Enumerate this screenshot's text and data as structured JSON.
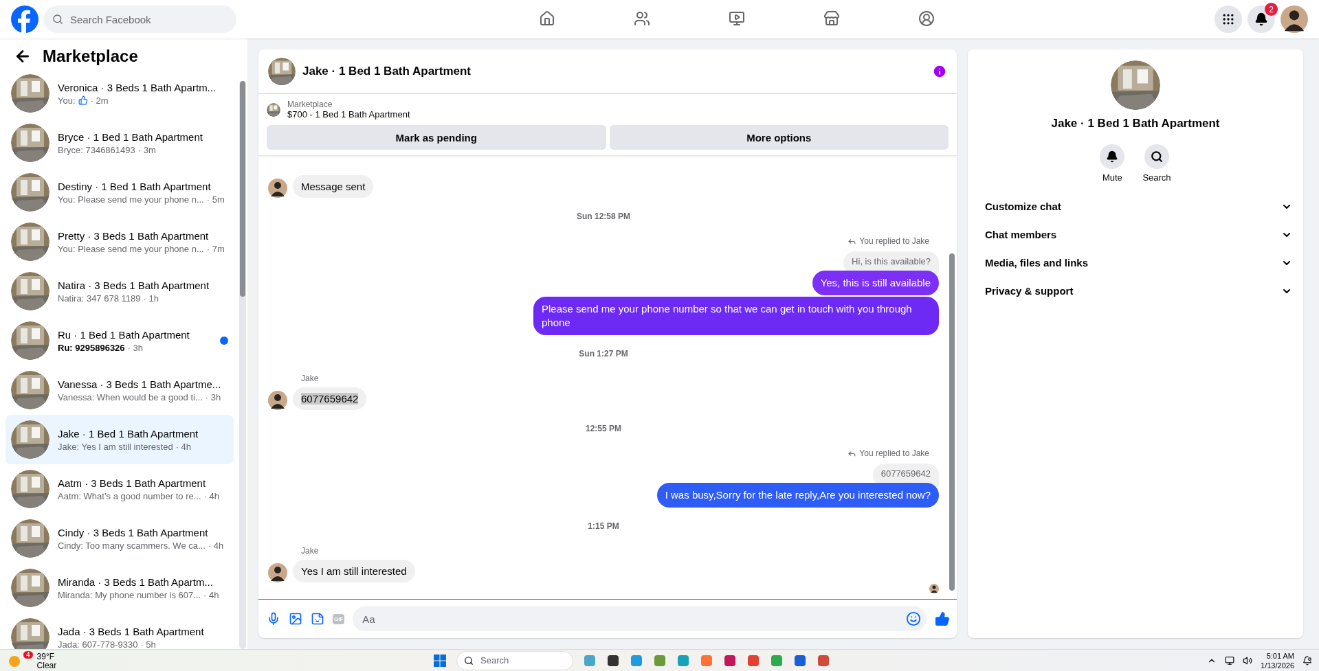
{
  "top_bar": {
    "search": {
      "placeholder": "Search Facebook"
    },
    "nav": [
      {
        "selected": false
      },
      {
        "selected": false
      },
      {
        "selected": false
      },
      {
        "selected": false
      },
      {
        "selected": false
      }
    ],
    "notifications_badge": "2"
  },
  "sidebar": {
    "title": "Marketplace",
    "conversations": [
      {
        "title": "Veronica · 3 Beds 1 Bath Apartm...",
        "preview": "You:",
        "kind": "like",
        "time": "· 2m",
        "unread": false,
        "selected": false
      },
      {
        "title": "Bryce · 1 Bed 1 Bath Apartment",
        "preview": "Bryce: 7346861493",
        "time": "· 3m",
        "unread": false,
        "selected": false
      },
      {
        "title": "Destiny · 1 Bed 1 Bath Apartment",
        "preview": "You: Please send me your phone n...",
        "time": "· 5m",
        "unread": false,
        "selected": false
      },
      {
        "title": "Pretty · 3 Beds 1 Bath Apartment",
        "preview": "You: Please send me your phone n...",
        "time": "· 7m",
        "unread": false,
        "selected": false
      },
      {
        "title": "Natira · 3 Beds 1 Bath Apartment",
        "preview": "Natira: 347 678 1189",
        "time": "· 1h",
        "unread": false,
        "selected": false
      },
      {
        "title": "Ru · 1 Bed 1 Bath Apartment",
        "preview": "Ru: 9295896326",
        "time": "· 3h",
        "unread": true,
        "selected": false
      },
      {
        "title": "Vanessa · 3 Beds 1 Bath Apartme...",
        "preview": "Vanessa: When would be a good ti...",
        "time": "· 3h",
        "unread": false,
        "selected": false
      },
      {
        "title": "Jake · 1 Bed 1 Bath Apartment",
        "preview": "Jake: Yes I am still interested",
        "time": "· 4h",
        "unread": false,
        "selected": true
      },
      {
        "title": "Aatm · 3 Beds 1 Bath Apartment",
        "preview": "Aatm: What’s a good number to re...",
        "time": "· 4h",
        "unread": false,
        "selected": false
      },
      {
        "title": "Cindy · 3 Beds 1 Bath Apartment",
        "preview": "Cindy: Too many scammers. We ca...",
        "time": "· 4h",
        "unread": false,
        "selected": false
      },
      {
        "title": "Miranda · 3 Beds 1 Bath Apartm...",
        "preview": "Miranda: My phone number is 607...",
        "time": "· 4h",
        "unread": false,
        "selected": false
      },
      {
        "title": "Jada · 3 Beds 1 Bath Apartment",
        "preview": "Jada: 607-778-9330",
        "time": "· 5h",
        "unread": false,
        "selected": false
      }
    ]
  },
  "chat": {
    "title": "Jake · 1 Bed 1 Bath Apartment",
    "listing": {
      "source": "Marketplace",
      "name": "$700 - 1 Bed 1 Bath Apartment"
    },
    "buttons": [
      "Mark as pending",
      "More options"
    ],
    "messages": [
      {
        "kind": "incoming",
        "text": "Message sent",
        "avatar": true,
        "highlighted": false
      },
      {
        "kind": "timestamp",
        "text": "Sun 12:58 PM"
      },
      {
        "kind": "reply_note",
        "text": "You replied to Jake"
      },
      {
        "kind": "quoted",
        "text": "Hi, is this available?"
      },
      {
        "kind": "outgoing",
        "text": "Yes, this is still available",
        "color": "#7b2ff7"
      },
      {
        "kind": "outgoing",
        "text": "Please send me your phone  number so that we can get in touch with you through phone",
        "color": "#6d2af5"
      },
      {
        "kind": "timestamp",
        "text": "Sun 1:27 PM"
      },
      {
        "kind": "sender",
        "text": "Jake"
      },
      {
        "kind": "incoming",
        "text": "6077659642",
        "avatar": true,
        "highlighted": true
      },
      {
        "kind": "timestamp",
        "text": "12:55 PM"
      },
      {
        "kind": "reply_note",
        "text": "You replied to Jake"
      },
      {
        "kind": "quoted",
        "text": "6077659642"
      },
      {
        "kind": "outgoing",
        "text": "I was busy,Sorry for the late reply,Are you interested now?",
        "color": "#2e5cf6"
      },
      {
        "kind": "timestamp",
        "text": "1:15 PM"
      },
      {
        "kind": "sender",
        "text": "Jake"
      },
      {
        "kind": "incoming",
        "text": "Yes I am still interested",
        "avatar": true,
        "highlighted": false
      }
    ],
    "composer": {
      "placeholder": "Aa",
      "gif_label": "GIF"
    }
  },
  "details": {
    "title": "Jake · 1 Bed 1 Bath Apartment",
    "actions": [
      {
        "label": "Mute"
      },
      {
        "label": "Search"
      }
    ],
    "sections": [
      {
        "label": "Customize chat",
        "expanded": false
      },
      {
        "label": "Chat members",
        "expanded": false
      },
      {
        "label": "Media, files and links",
        "expanded": false
      },
      {
        "label": "Privacy & support",
        "expanded": false
      }
    ]
  },
  "taskbar": {
    "weather": {
      "badge": "4",
      "temperature": "39°F",
      "condition": "Clear"
    },
    "search": {
      "placeholder": "Search"
    },
    "time": "5:01 AM",
    "date": "1/13/2026"
  }
}
